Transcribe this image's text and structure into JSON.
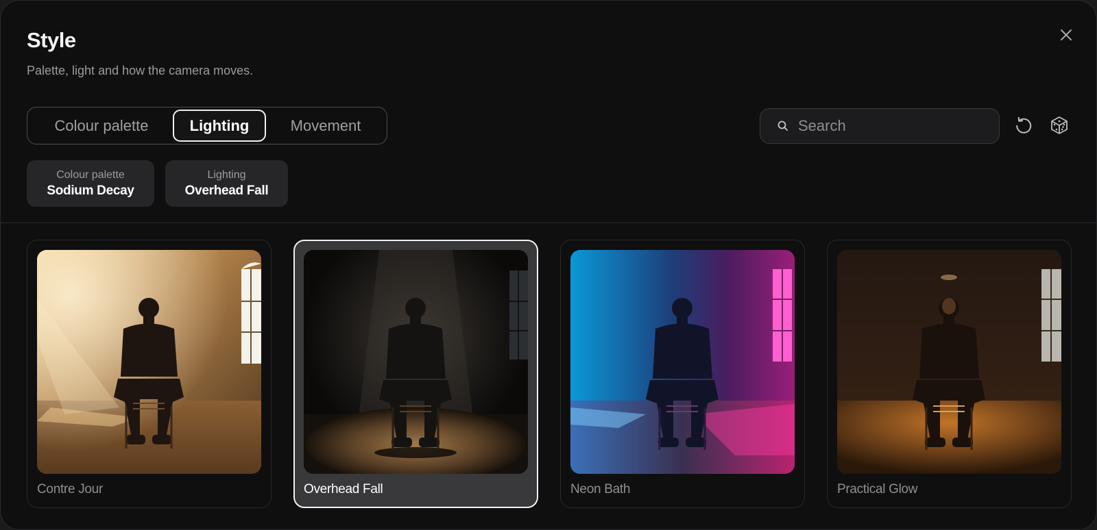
{
  "header": {
    "title": "Style",
    "subtitle": "Palette, light and how the camera moves."
  },
  "tabs": [
    {
      "label": "Colour palette",
      "active": false
    },
    {
      "label": "Lighting",
      "active": true
    },
    {
      "label": "Movement",
      "active": false
    }
  ],
  "search": {
    "placeholder": "Search",
    "value": ""
  },
  "selections": [
    {
      "label": "Colour palette",
      "value": "Sodium Decay"
    },
    {
      "label": "Lighting",
      "value": "Overhead Fall"
    }
  ],
  "cards": [
    {
      "label": "Contre Jour",
      "selected": false,
      "image": "backlit-warm-fog"
    },
    {
      "label": "Overhead Fall",
      "selected": true,
      "image": "overhead-spotlight"
    },
    {
      "label": "Neon Bath",
      "selected": false,
      "image": "neon-blue-magenta"
    },
    {
      "label": "Practical Glow",
      "selected": false,
      "image": "warm-practical-glow"
    }
  ],
  "colors": {
    "background": "#0f0f10",
    "active_border": "#f2f2f2",
    "chip_bg": "#262628",
    "selected_card_bg": "#39393b"
  }
}
